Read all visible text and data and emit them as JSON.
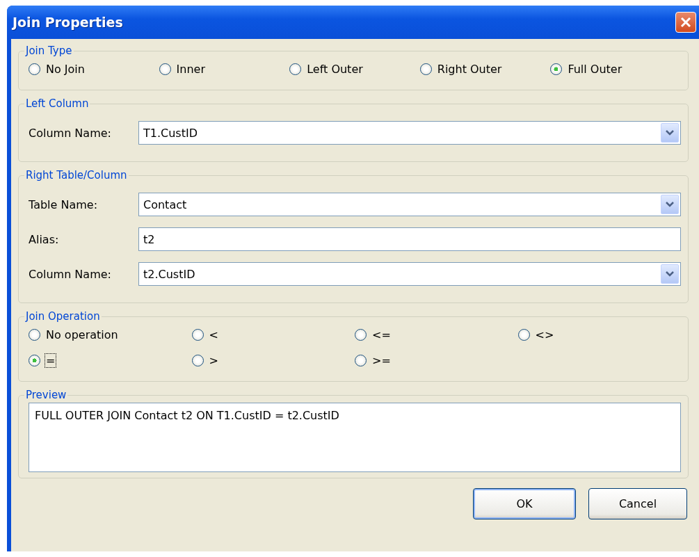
{
  "window": {
    "title": "Join Properties"
  },
  "join_type": {
    "legend": "Join Type",
    "options": [
      {
        "label": "No Join",
        "selected": false
      },
      {
        "label": "Inner",
        "selected": false
      },
      {
        "label": "Left Outer",
        "selected": false
      },
      {
        "label": "Right Outer",
        "selected": false
      },
      {
        "label": "Full Outer",
        "selected": true
      }
    ]
  },
  "left_column": {
    "legend": "Left Column",
    "fields": [
      {
        "label": "Column Name:",
        "value": "T1.CustID",
        "kind": "dropdown"
      }
    ]
  },
  "right_table": {
    "legend": "Right Table/Column",
    "fields": [
      {
        "label": "Table Name:",
        "value": "Contact",
        "kind": "dropdown"
      },
      {
        "label": "Alias:",
        "value": "t2",
        "kind": "text"
      },
      {
        "label": "Column Name:",
        "value": "t2.CustID",
        "kind": "dropdown"
      }
    ]
  },
  "join_operation": {
    "legend": "Join Operation",
    "options": [
      {
        "label": "No operation",
        "selected": false,
        "focused": false
      },
      {
        "label": "<",
        "selected": false,
        "focused": false
      },
      {
        "label": "<=",
        "selected": false,
        "focused": false
      },
      {
        "label": "<>",
        "selected": false,
        "focused": false
      },
      {
        "label": "=",
        "selected": true,
        "focused": true
      },
      {
        "label": ">",
        "selected": false,
        "focused": false
      },
      {
        "label": ">=",
        "selected": false,
        "focused": false
      }
    ]
  },
  "preview": {
    "legend": "Preview",
    "text": "FULL OUTER JOIN Contact t2 ON T1.CustID = t2.CustID"
  },
  "buttons": [
    {
      "label": "OK",
      "default": true
    },
    {
      "label": "Cancel",
      "default": false
    }
  ]
}
